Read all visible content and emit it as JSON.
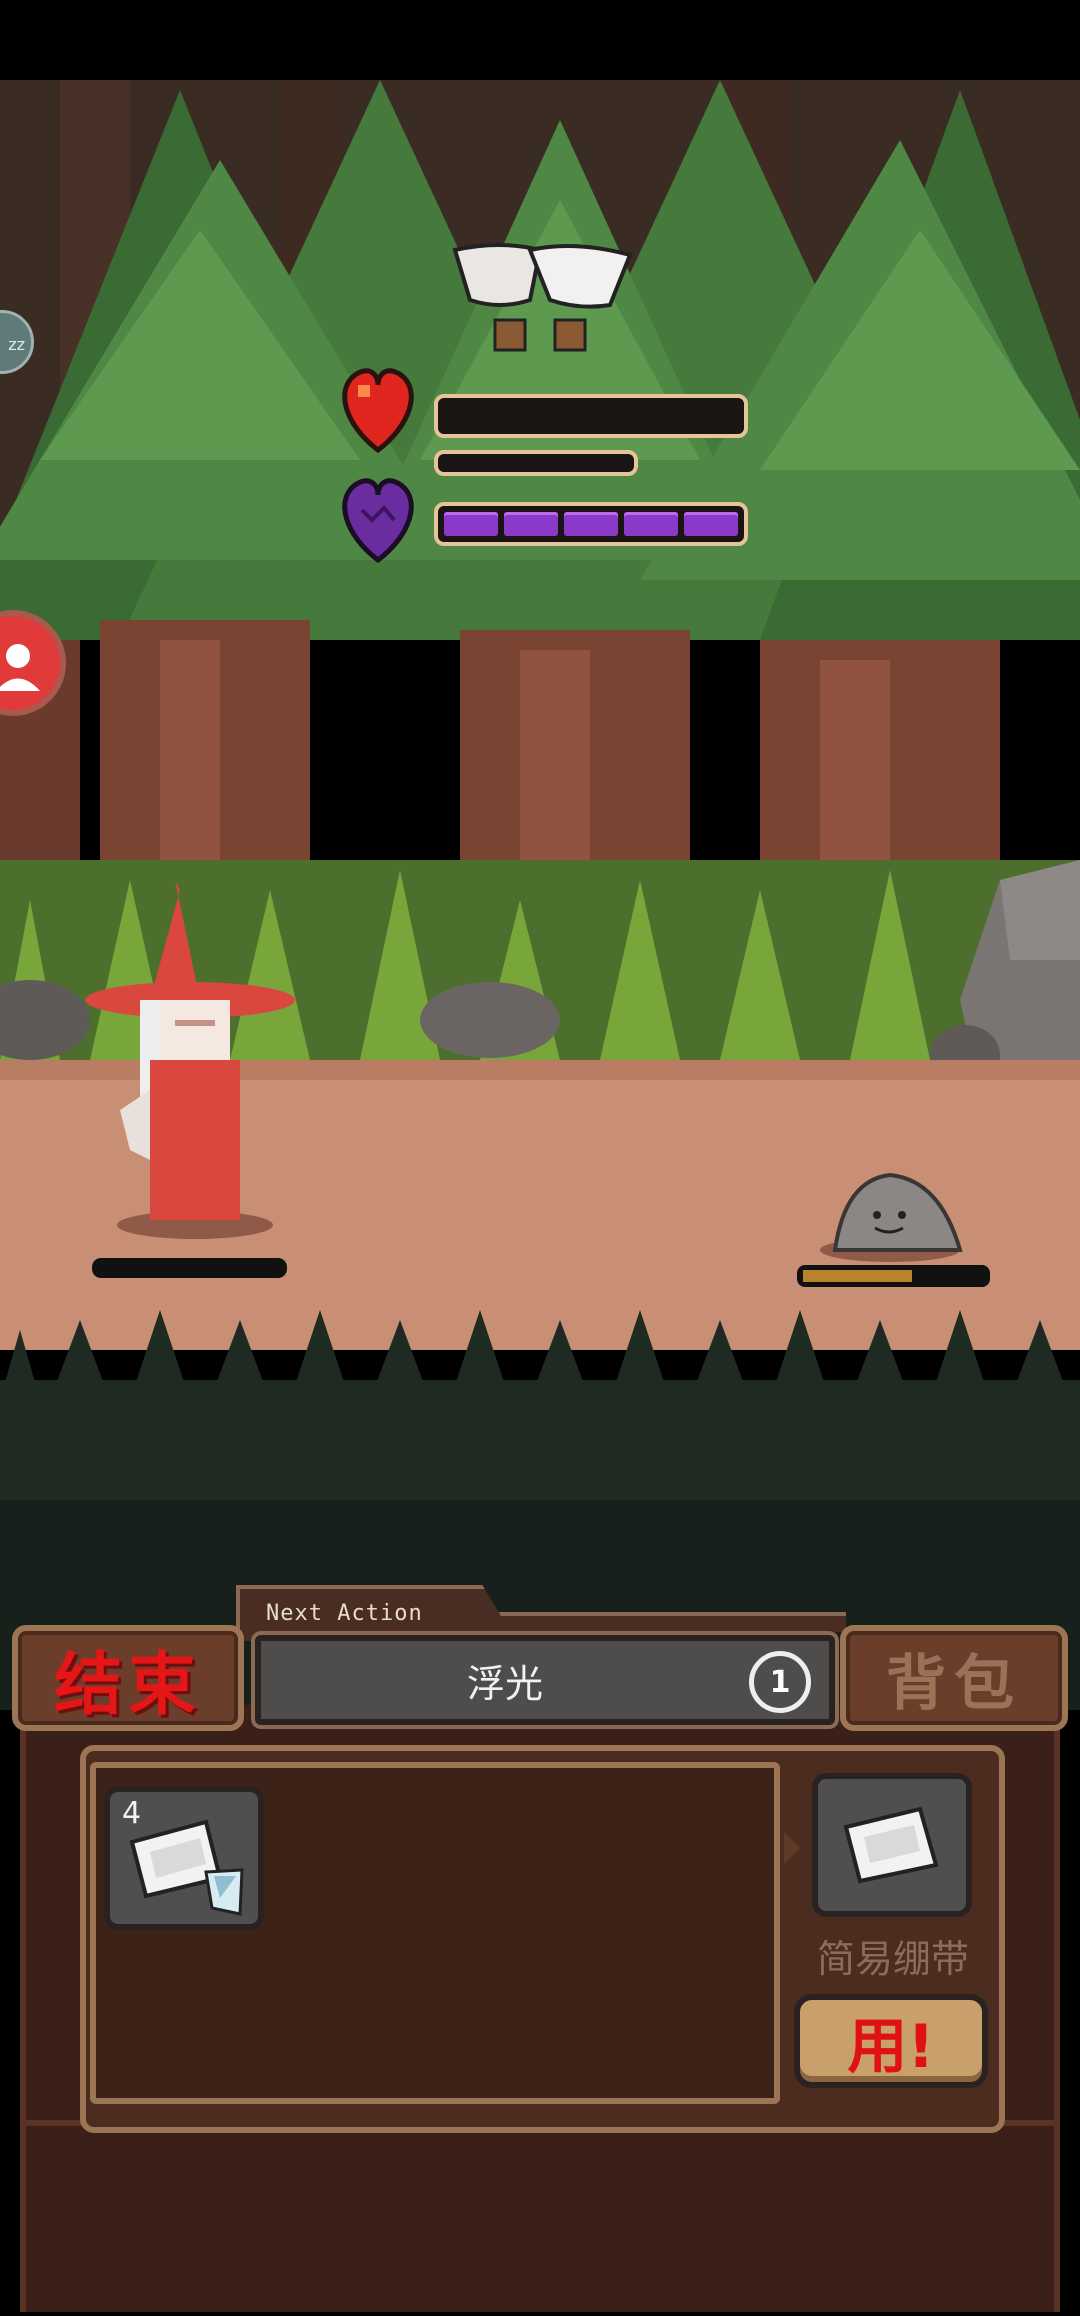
{
  "hud": {
    "health_fraction": 0.0,
    "mana_segments_filled": 5,
    "mana_segments_total": 5
  },
  "side_buttons": {
    "sleep_label": "zz"
  },
  "action_panel": {
    "tab_label": "Next Action",
    "current_action": "浮光",
    "cycle_count": "1"
  },
  "buttons": {
    "end_turn": "结束",
    "backpack": "背包",
    "use": "用!"
  },
  "inventory": {
    "items": [
      {
        "name": "简易绷带",
        "count": "4",
        "icon": "bandage-icon"
      }
    ],
    "selected_item_name": "简易绷带"
  },
  "enemy": {
    "name_shown": "",
    "hp_fraction": 0.6
  },
  "colors": {
    "mana": "#8a39c9",
    "heart": "#e0261f",
    "end_text": "#e51616",
    "panel": "#3a2019"
  }
}
